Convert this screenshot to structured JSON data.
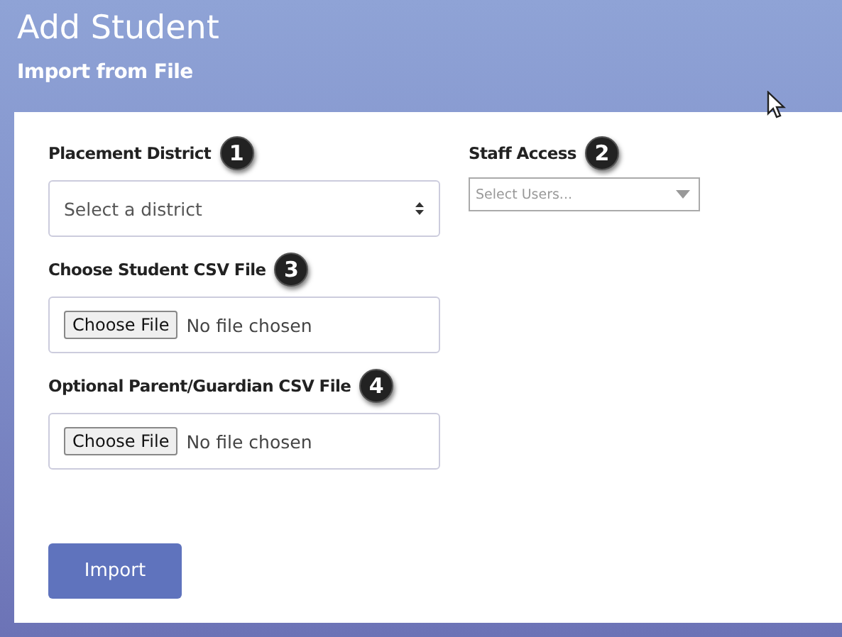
{
  "title": "Add Student",
  "subtitle": "Import from File",
  "placement_district": {
    "label": "Placement District",
    "badge": "1",
    "placeholder": "Select a district"
  },
  "staff_access": {
    "label": "Staff Access",
    "badge": "2",
    "placeholder": "Select Users..."
  },
  "student_csv": {
    "label": "Choose Student CSV File",
    "badge": "3",
    "button": "Choose File",
    "status": "No file chosen"
  },
  "parent_csv": {
    "label": "Optional Parent/Guardian CSV File",
    "badge": "4",
    "button": "Choose File",
    "status": "No file chosen"
  },
  "import_button": "Import"
}
